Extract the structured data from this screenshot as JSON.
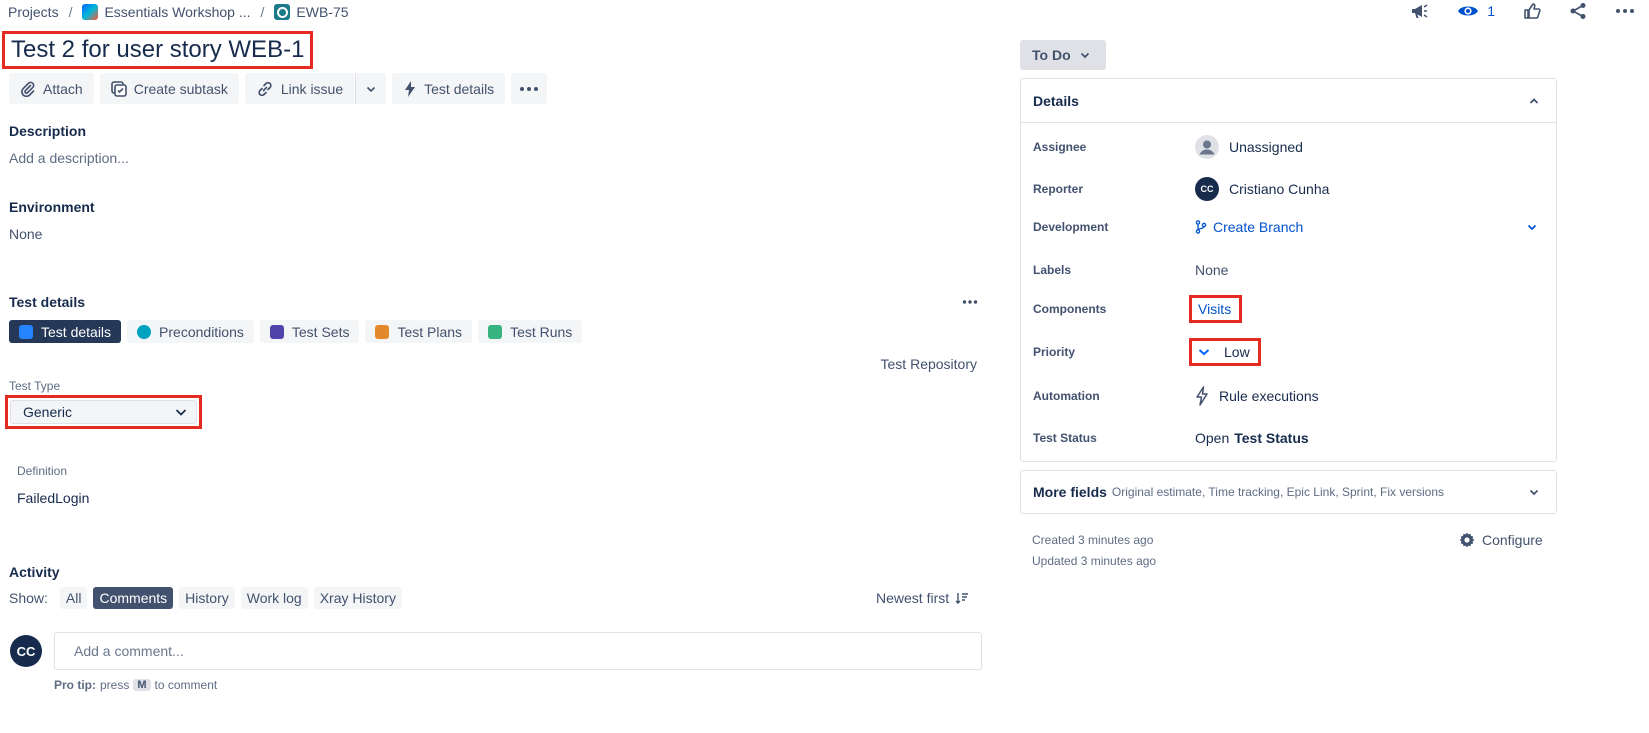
{
  "breadcrumb": {
    "projects": "Projects",
    "sep": "/",
    "project": "Essentials Workshop ...",
    "issue_key": "EWB-75"
  },
  "top_actions": {
    "watchers": "1"
  },
  "issue": {
    "title": "Test 2 for user story WEB-1"
  },
  "toolbar": {
    "attach": "Attach",
    "create_subtask": "Create subtask",
    "link_issue": "Link issue",
    "test_details": "Test details"
  },
  "description": {
    "heading": "Description",
    "placeholder": "Add a description..."
  },
  "environment": {
    "heading": "Environment",
    "value": "None"
  },
  "test_details": {
    "heading": "Test details",
    "tabs": [
      {
        "label": "Test details",
        "color": "#2684ff"
      },
      {
        "label": "Preconditions",
        "color": "#00a3bf"
      },
      {
        "label": "Test Sets",
        "color": "#5243aa"
      },
      {
        "label": "Test Plans",
        "color": "#e2892d"
      },
      {
        "label": "Test Runs",
        "color": "#36b37e"
      }
    ],
    "repository_link": "Test Repository",
    "test_type_label": "Test Type",
    "test_type_value": "Generic",
    "definition_label": "Definition",
    "definition_value": "FailedLogin"
  },
  "activity": {
    "heading": "Activity",
    "show_label": "Show:",
    "filters": [
      "All",
      "Comments",
      "History",
      "Work log",
      "Xray History"
    ],
    "active_filter": "Comments",
    "sort": "Newest first",
    "avatar_initials": "CC",
    "comment_placeholder": "Add a comment...",
    "protip_prefix": "Pro tip:",
    "protip_press": "press",
    "protip_key": "M",
    "protip_suffix": "to comment"
  },
  "sidebar": {
    "status": "To Do",
    "details_heading": "Details",
    "fields": {
      "assignee": {
        "label": "Assignee",
        "value": "Unassigned"
      },
      "reporter": {
        "label": "Reporter",
        "value": "Cristiano Cunha",
        "initials": "CC"
      },
      "development": {
        "label": "Development",
        "value": "Create Branch"
      },
      "labels": {
        "label": "Labels",
        "value": "None"
      },
      "components": {
        "label": "Components",
        "value": "Visits"
      },
      "priority": {
        "label": "Priority",
        "value": "Low"
      },
      "automation": {
        "label": "Automation",
        "value": "Rule executions"
      },
      "test_status": {
        "label": "Test Status",
        "prefix": "Open",
        "value": "Test Status"
      }
    },
    "more_fields": {
      "heading": "More fields",
      "summary": "Original estimate, Time tracking, Epic Link, Sprint, Fix versions"
    },
    "created": "Created 3 minutes ago",
    "updated": "Updated 3 minutes ago",
    "configure": "Configure"
  },
  "colors": {
    "accent": "#0052cc",
    "highlight": "#e52b1f",
    "active_tab": "#253858"
  }
}
